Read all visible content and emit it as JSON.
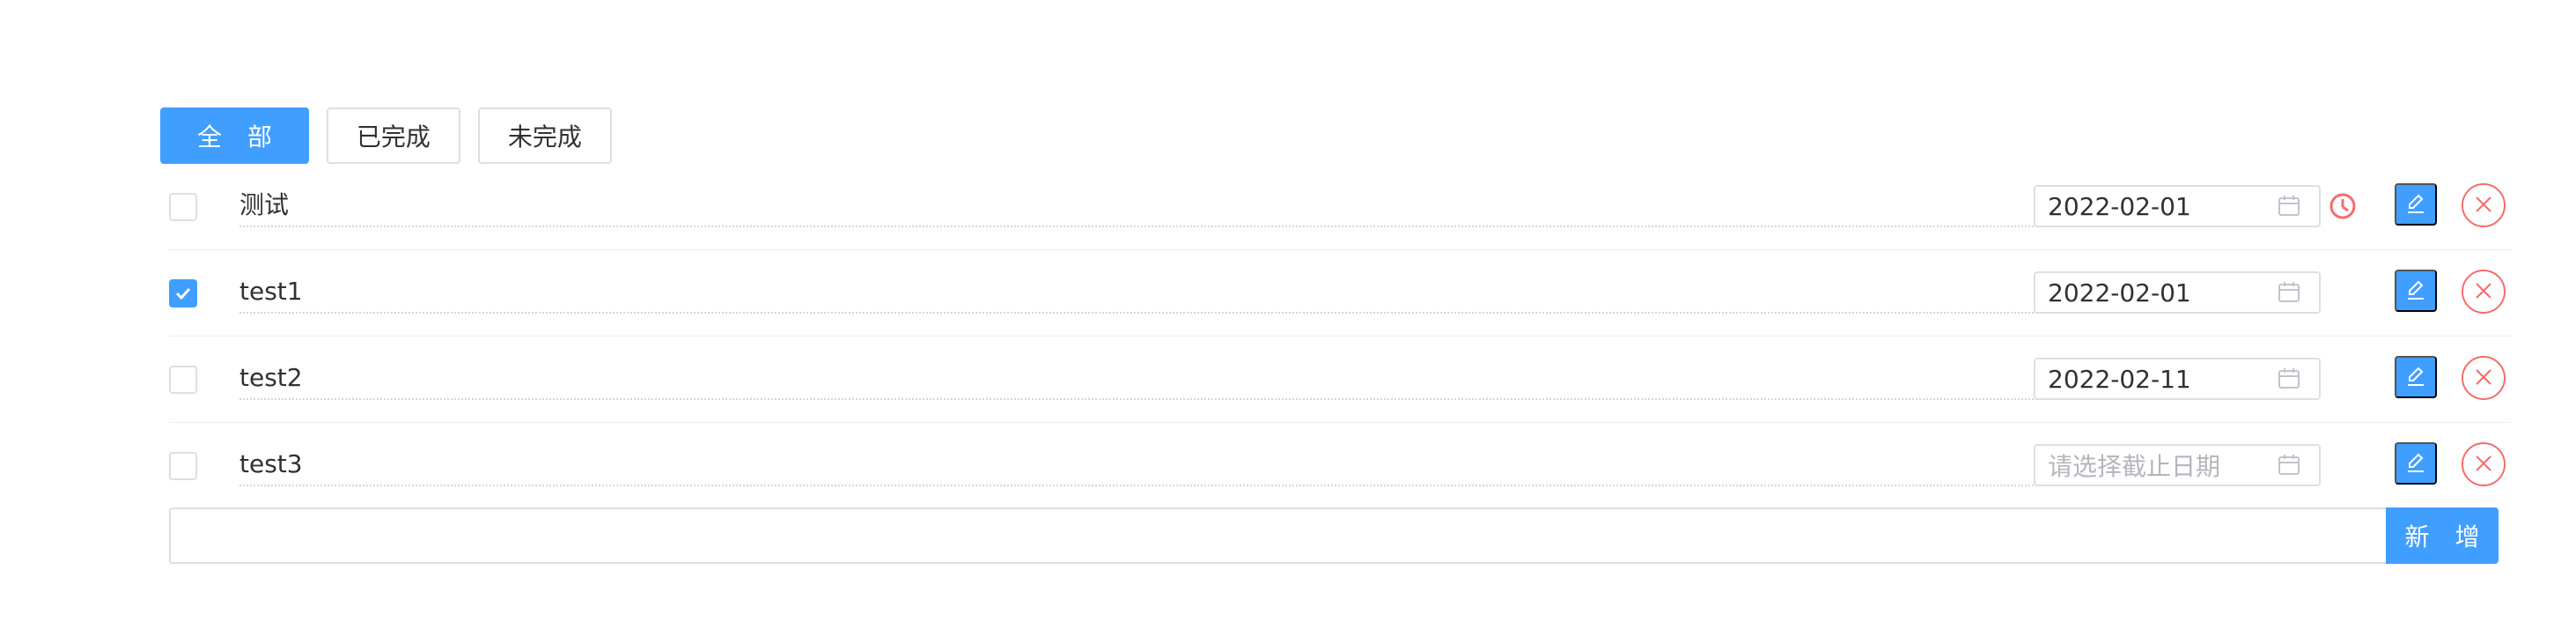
{
  "filters": [
    {
      "label": "全 部",
      "active": true
    },
    {
      "label": "已完成",
      "active": false
    },
    {
      "label": "未完成",
      "active": false
    }
  ],
  "todos": [
    {
      "text": "测试",
      "done": false,
      "date": "2022-02-01",
      "overdue": true
    },
    {
      "text": "test1",
      "done": true,
      "date": "2022-02-01",
      "overdue": false
    },
    {
      "text": "test2",
      "done": false,
      "date": "2022-02-11",
      "overdue": false
    },
    {
      "text": "test3",
      "done": false,
      "date": "",
      "overdue": false
    }
  ],
  "date_placeholder": "请选择截止日期",
  "add": {
    "input_value": "",
    "button_label": "新 增"
  },
  "colors": {
    "primary": "#409eff",
    "danger": "#f56c6c",
    "border": "#dcdfe6"
  }
}
